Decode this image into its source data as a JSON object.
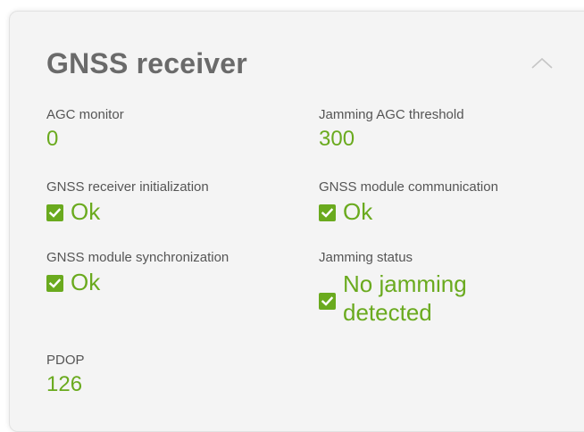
{
  "card": {
    "title": "GNSS receiver",
    "collapse_icon": "chevron-up-icon"
  },
  "fields": {
    "agc_monitor": {
      "label": "AGC monitor",
      "value": "0"
    },
    "jamming_agc_threshold": {
      "label": "Jamming AGC threshold",
      "value": "300"
    },
    "receiver_init": {
      "label": "GNSS receiver initialization",
      "value": "Ok",
      "icon": "checkbox-checked-icon"
    },
    "module_comm": {
      "label": "GNSS module communication",
      "value": "Ok",
      "icon": "checkbox-checked-icon"
    },
    "module_sync": {
      "label": "GNSS module synchronization",
      "value": "Ok",
      "icon": "checkbox-checked-icon"
    },
    "jamming_status": {
      "label": "Jamming status",
      "value_line1": "No jamming",
      "value_line2": "detected",
      "icon": "checkbox-checked-icon"
    },
    "pdop": {
      "label": "PDOP",
      "value": "126"
    }
  },
  "colors": {
    "accent_green": "#6aaa1e",
    "title_gray": "#6a6a6a",
    "label_gray": "#555555",
    "card_background": "#f4f4f4"
  }
}
